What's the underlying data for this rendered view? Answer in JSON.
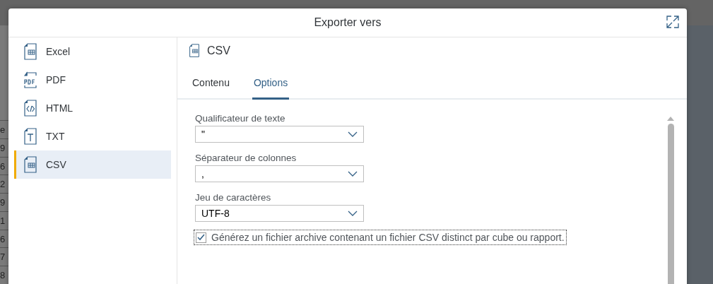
{
  "background_table": {
    "cells": [
      "e",
      "9",
      "6",
      "2",
      "9",
      "1",
      "6",
      "7",
      "8"
    ]
  },
  "dialog": {
    "title": "Exporter vers",
    "formats": [
      {
        "label": "Excel",
        "kind": "grid",
        "selected": false
      },
      {
        "label": "PDF",
        "kind": "pdf",
        "selected": false
      },
      {
        "label": "HTML",
        "kind": "code",
        "selected": false
      },
      {
        "label": "TXT",
        "kind": "text",
        "selected": false
      },
      {
        "label": "CSV",
        "kind": "grid",
        "selected": true
      }
    ],
    "panel": {
      "title": "CSV",
      "kind": "grid",
      "tabs": [
        {
          "label": "Contenu",
          "selected": false
        },
        {
          "label": "Options",
          "selected": true
        }
      ],
      "fields": [
        {
          "label": "Qualificateur de texte",
          "value": "\""
        },
        {
          "label": "Séparateur de colonnes",
          "value": ","
        },
        {
          "label": "Jeu de caractères",
          "value": "UTF-8"
        }
      ],
      "checkbox": {
        "label": "Générez un fichier archive contenant un fichier CSV distinct par cube ou rapport.",
        "checked": true
      }
    }
  }
}
